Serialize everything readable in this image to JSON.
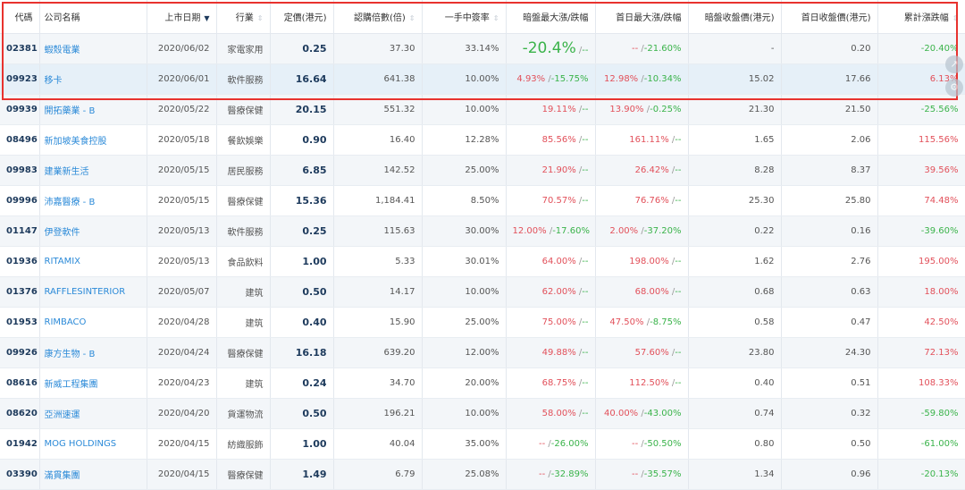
{
  "headers": {
    "code": "代碼",
    "name": "公司名稱",
    "date": "上市日期",
    "industry": "行業",
    "price": "定價(港元)",
    "sub": "認購倍數(倍)",
    "lot": "一手中簽率",
    "grey_range": "暗盤最大漲/跌幅",
    "first_range": "首日最大漲/跌幅",
    "grey_close": "暗盤收盤價(港元)",
    "first_close": "首日收盤價(港元)",
    "cum": "累計漲跌幅"
  },
  "rows": [
    {
      "code": "02381",
      "name": "蝦殼電業",
      "date": "2020/06/02",
      "industry": "家電家用",
      "price": "0.25",
      "sub": "37.30",
      "lot": "33.14%",
      "gu": "-20.4%",
      "gd": "--",
      "fu": "--",
      "fd": "-21.60%",
      "gc": "-",
      "fc": "0.20",
      "cum": "-20.40%"
    },
    {
      "code": "09923",
      "name": "移卡",
      "date": "2020/06/01",
      "industry": "軟件服務",
      "price": "16.64",
      "sub": "641.38",
      "lot": "10.00%",
      "gu": "4.93%",
      "gd": "-15.75%",
      "fu": "12.98%",
      "fd": "-10.34%",
      "gc": "15.02",
      "fc": "17.66",
      "cum": "6.13%"
    },
    {
      "code": "09939",
      "name": "開拓藥業 - B",
      "date": "2020/05/22",
      "industry": "醫療保健",
      "price": "20.15",
      "sub": "551.32",
      "lot": "10.00%",
      "gu": "19.11%",
      "gd": "--",
      "fu": "13.90%",
      "fd": "-0.25%",
      "gc": "21.30",
      "fc": "21.50",
      "cum": "-25.56%"
    },
    {
      "code": "08496",
      "name": "新加坡美食控股",
      "date": "2020/05/18",
      "industry": "餐飲娛樂",
      "price": "0.90",
      "sub": "16.40",
      "lot": "12.28%",
      "gu": "85.56%",
      "gd": "--",
      "fu": "161.11%",
      "fd": "--",
      "gc": "1.65",
      "fc": "2.06",
      "cum": "115.56%"
    },
    {
      "code": "09983",
      "name": "建業新生活",
      "date": "2020/05/15",
      "industry": "居民服務",
      "price": "6.85",
      "sub": "142.52",
      "lot": "25.00%",
      "gu": "21.90%",
      "gd": "--",
      "fu": "26.42%",
      "fd": "--",
      "gc": "8.28",
      "fc": "8.37",
      "cum": "39.56%"
    },
    {
      "code": "09996",
      "name": "沛嘉醫療 - B",
      "date": "2020/05/15",
      "industry": "醫療保健",
      "price": "15.36",
      "sub": "1,184.41",
      "lot": "8.50%",
      "gu": "70.57%",
      "gd": "--",
      "fu": "76.76%",
      "fd": "--",
      "gc": "25.30",
      "fc": "25.80",
      "cum": "74.48%"
    },
    {
      "code": "01147",
      "name": "伊登軟件",
      "date": "2020/05/13",
      "industry": "軟件服務",
      "price": "0.25",
      "sub": "115.63",
      "lot": "30.00%",
      "gu": "12.00%",
      "gd": "-17.60%",
      "fu": "2.00%",
      "fd": "-37.20%",
      "gc": "0.22",
      "fc": "0.16",
      "cum": "-39.60%"
    },
    {
      "code": "01936",
      "name": "RITAMIX",
      "date": "2020/05/13",
      "industry": "食品飲料",
      "price": "1.00",
      "sub": "5.33",
      "lot": "30.01%",
      "gu": "64.00%",
      "gd": "--",
      "fu": "198.00%",
      "fd": "--",
      "gc": "1.62",
      "fc": "2.76",
      "cum": "195.00%"
    },
    {
      "code": "01376",
      "name": "RAFFLESINTERIOR",
      "date": "2020/05/07",
      "industry": "建筑",
      "price": "0.50",
      "sub": "14.17",
      "lot": "10.00%",
      "gu": "62.00%",
      "gd": "--",
      "fu": "68.00%",
      "fd": "--",
      "gc": "0.68",
      "fc": "0.63",
      "cum": "18.00%"
    },
    {
      "code": "01953",
      "name": "RIMBACO",
      "date": "2020/04/28",
      "industry": "建筑",
      "price": "0.40",
      "sub": "15.90",
      "lot": "25.00%",
      "gu": "75.00%",
      "gd": "--",
      "fu": "47.50%",
      "fd": "-8.75%",
      "gc": "0.58",
      "fc": "0.47",
      "cum": "42.50%"
    },
    {
      "code": "09926",
      "name": "康方生物 - B",
      "date": "2020/04/24",
      "industry": "醫療保健",
      "price": "16.18",
      "sub": "639.20",
      "lot": "12.00%",
      "gu": "49.88%",
      "gd": "--",
      "fu": "57.60%",
      "fd": "--",
      "gc": "23.80",
      "fc": "24.30",
      "cum": "72.13%"
    },
    {
      "code": "08616",
      "name": "新威工程集團",
      "date": "2020/04/23",
      "industry": "建筑",
      "price": "0.24",
      "sub": "34.70",
      "lot": "20.00%",
      "gu": "68.75%",
      "gd": "--",
      "fu": "112.50%",
      "fd": "--",
      "gc": "0.40",
      "fc": "0.51",
      "cum": "108.33%"
    },
    {
      "code": "08620",
      "name": "亞洲速運",
      "date": "2020/04/20",
      "industry": "貨運物流",
      "price": "0.50",
      "sub": "196.21",
      "lot": "10.00%",
      "gu": "58.00%",
      "gd": "--",
      "fu": "40.00%",
      "fd": "-43.00%",
      "gc": "0.74",
      "fc": "0.32",
      "cum": "-59.80%"
    },
    {
      "code": "01942",
      "name": "MOG HOLDINGS",
      "date": "2020/04/15",
      "industry": "紡織服飾",
      "price": "1.00",
      "sub": "40.04",
      "lot": "35.00%",
      "gu": "--",
      "gd": "-26.00%",
      "fu": "--",
      "fd": "-50.50%",
      "gc": "0.80",
      "fc": "0.50",
      "cum": "-61.00%"
    },
    {
      "code": "03390",
      "name": "滿貫集團",
      "date": "2020/04/15",
      "industry": "醫療保健",
      "price": "1.49",
      "sub": "6.79",
      "lot": "25.08%",
      "gu": "--",
      "gd": "-32.89%",
      "fu": "--",
      "fd": "-35.57%",
      "gc": "1.34",
      "fc": "0.96",
      "cum": "-20.13%"
    }
  ],
  "colors": {
    "up": "#e2505a",
    "down": "#3ab34a",
    "highlight": "#e8322e"
  }
}
